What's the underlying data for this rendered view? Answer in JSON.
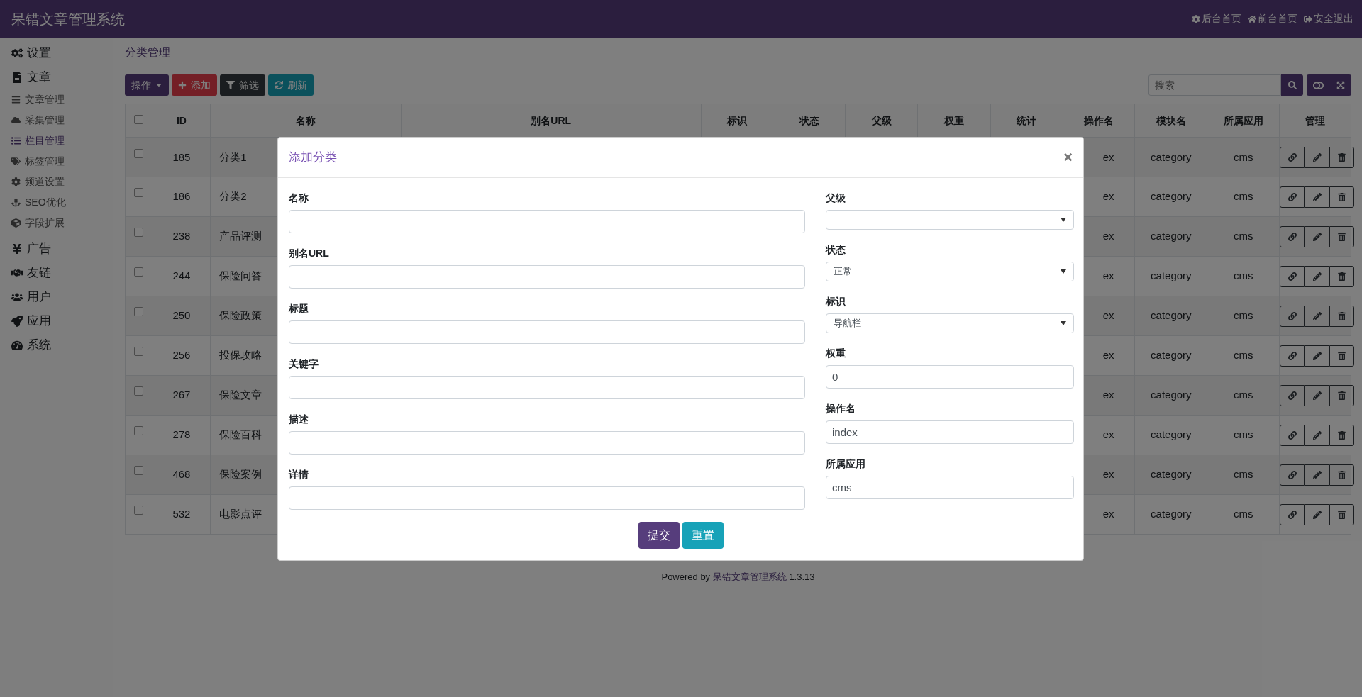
{
  "header": {
    "title": "呆错文章管理系统",
    "links": [
      {
        "label": "后台首页"
      },
      {
        "label": "前台首页"
      },
      {
        "label": "安全退出"
      }
    ]
  },
  "sidebar": {
    "items": [
      {
        "label": "设置",
        "selected": false
      },
      {
        "label": "文章",
        "selected": false,
        "children": [
          {
            "label": "文章管理",
            "selected": false
          },
          {
            "label": "采集管理",
            "selected": false
          },
          {
            "label": "栏目管理",
            "selected": true
          },
          {
            "label": "标签管理",
            "selected": false
          },
          {
            "label": "频道设置",
            "selected": false
          },
          {
            "label": "SEO优化",
            "selected": false
          },
          {
            "label": "字段扩展",
            "selected": false
          }
        ]
      },
      {
        "label": "广告",
        "selected": false
      },
      {
        "label": "友链",
        "selected": false
      },
      {
        "label": "用户",
        "selected": false
      },
      {
        "label": "应用",
        "selected": false
      },
      {
        "label": "系统",
        "selected": false
      }
    ]
  },
  "breadcrumb": "分类管理",
  "toolbar": {
    "buttons": [
      {
        "label": "操作",
        "kind": "dropdown"
      },
      {
        "label": "添加",
        "kind": "danger"
      },
      {
        "label": "筛选",
        "kind": "dark"
      },
      {
        "label": "刷新",
        "kind": "info"
      }
    ],
    "search": {
      "placeholder": "搜索"
    }
  },
  "table": {
    "header_checked": false,
    "columns": [
      "ID",
      "名称",
      "别名URL",
      "标识",
      "状态",
      "父级",
      "权重",
      "统计",
      "操作名",
      "模块名",
      "所属应用",
      "管理"
    ],
    "rows": [
      {
        "checked": false,
        "id": "185",
        "name": "分类1",
        "action": "ex",
        "module": "category",
        "app": "cms"
      },
      {
        "checked": false,
        "id": "186",
        "name": "分类2",
        "action": "ex",
        "module": "category",
        "app": "cms"
      },
      {
        "checked": false,
        "id": "238",
        "name": "产品评测",
        "action": "ex",
        "module": "category",
        "app": "cms"
      },
      {
        "checked": false,
        "id": "244",
        "name": "保险问答",
        "action": "ex",
        "module": "category",
        "app": "cms"
      },
      {
        "checked": false,
        "id": "250",
        "name": "保险政策",
        "action": "ex",
        "module": "category",
        "app": "cms"
      },
      {
        "checked": false,
        "id": "256",
        "name": "投保攻略",
        "action": "ex",
        "module": "category",
        "app": "cms"
      },
      {
        "checked": false,
        "id": "267",
        "name": "保险文章",
        "action": "ex",
        "module": "category",
        "app": "cms"
      },
      {
        "checked": false,
        "id": "278",
        "name": "保险百科",
        "action": "ex",
        "module": "category",
        "app": "cms"
      },
      {
        "checked": false,
        "id": "468",
        "name": "保险案例",
        "action": "ex",
        "module": "category",
        "app": "cms"
      },
      {
        "checked": false,
        "id": "532",
        "name": "电影点评",
        "action": "ex",
        "module": "category",
        "app": "cms"
      }
    ]
  },
  "modal": {
    "title": "添加分类",
    "close": "×",
    "left_fields": [
      {
        "label": "名称",
        "kind": "input"
      },
      {
        "label": "别名URL",
        "kind": "input"
      },
      {
        "label": "标题",
        "kind": "input"
      },
      {
        "label": "关键字",
        "kind": "input"
      },
      {
        "label": "描述",
        "kind": "input"
      },
      {
        "label": "详情",
        "kind": "input"
      }
    ],
    "right_fields": [
      {
        "label": "父级",
        "kind": "select"
      },
      {
        "label": "状态",
        "kind": "select",
        "value": "正常"
      },
      {
        "label": "标识",
        "kind": "select",
        "value": "导航栏"
      },
      {
        "label": "权重",
        "kind": "input",
        "value": "0"
      },
      {
        "label": "操作名",
        "kind": "input",
        "value": "index"
      },
      {
        "label": "所属应用",
        "kind": "input",
        "value": "cms"
      }
    ],
    "buttons": [
      {
        "label": "提交",
        "kind": "primary"
      },
      {
        "label": "重置",
        "kind": "info"
      }
    ]
  },
  "footer": {
    "prefix": "Powered by",
    "link": "呆错文章管理系统",
    "version": "1.3.13"
  }
}
